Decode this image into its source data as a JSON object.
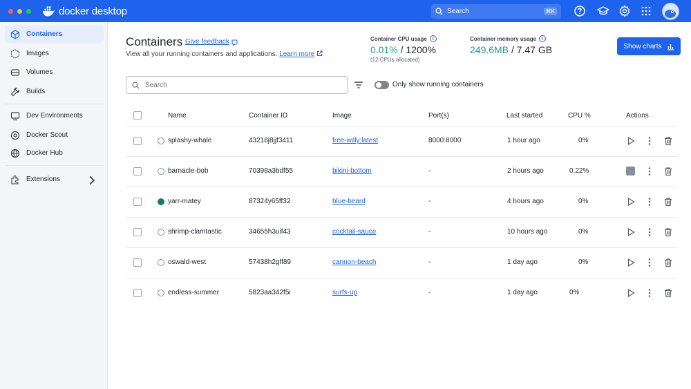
{
  "app": {
    "brand_name": "docker desktop",
    "search_placeholder": "Search",
    "search_shortcut": "⌘K",
    "icons": [
      "help-icon",
      "learn-icon",
      "settings-icon",
      "apps-grid-icon",
      "avatar"
    ]
  },
  "sidebar": {
    "items": [
      {
        "label": "Containers",
        "icon": "container-icon",
        "active": true
      },
      {
        "label": "Images",
        "icon": "images-icon"
      },
      {
        "label": "Volumes",
        "icon": "volumes-icon"
      },
      {
        "label": "Builds",
        "icon": "builds-icon"
      },
      {
        "label": "Dev Environments",
        "icon": "dev-env-icon"
      },
      {
        "label": "Docker Scout",
        "icon": "scout-icon"
      },
      {
        "label": "Docker Hub",
        "icon": "hub-icon"
      },
      {
        "label": "Extensions",
        "icon": "extensions-icon"
      }
    ]
  },
  "header": {
    "title": "Containers",
    "feedback_link": "Give feedback",
    "subtitle": "View all your running containers and applications.",
    "learn_more": "Learn more",
    "cpu_label": "Container CPU usage",
    "cpu_value": "0.01%",
    "cpu_total": "/ 1200%",
    "cpu_note": "(12 CPUs allocated)",
    "mem_label": "Container memory usage",
    "mem_value": "249.6MB",
    "mem_total": "/ 7.47 GB",
    "show_charts": "Show charts"
  },
  "filters": {
    "search_placeholder": "Search",
    "toggle_label": "Only show running containers",
    "toggle_on": false
  },
  "table": {
    "columns": [
      "Name",
      "Container ID",
      "Image",
      "Port(s)",
      "Last started",
      "CPU %",
      "Actions"
    ],
    "rows": [
      {
        "name": "splashy-whale",
        "id": "43218j8jjf3411",
        "image": "free-willy:latest",
        "ports": "8000:8000",
        "last_started": "1 hour ago",
        "cpu": "0%",
        "running": false
      },
      {
        "name": "barnacle-bob",
        "id": "70398a3bdf55",
        "image": "bikini-bottom",
        "ports": "-",
        "last_started": "2 hours ago",
        "cpu": "0.22%",
        "running": true
      },
      {
        "name": "yarr-matey",
        "id": "87324y65ff32",
        "image": "blue-beard",
        "ports": "-",
        "last_started": "4 hours ago",
        "cpu": "0%",
        "running": false
      },
      {
        "name": "shrimp-clamtastic",
        "id": "34655h3uif43",
        "image": "cocktail-sauce",
        "ports": "-",
        "last_started": "10 hours ago",
        "cpu": "0%",
        "running": false
      },
      {
        "name": "oswald-west",
        "id": "57438h2gff89",
        "image": "cannon-beach",
        "ports": "-",
        "last_started": "1 day ago",
        "cpu": "0%",
        "running": false
      },
      {
        "name": "endless-summer",
        "id": "5823aa342f5i",
        "image": "surfs-up",
        "ports": "-",
        "last_started": "1 day ago",
        "cpu": "0%",
        "running": false
      }
    ]
  },
  "colors": {
    "brand_blue": "#1d63ed",
    "metric_green": "#1a9e8f",
    "running_dot": "#1d7a6b"
  }
}
